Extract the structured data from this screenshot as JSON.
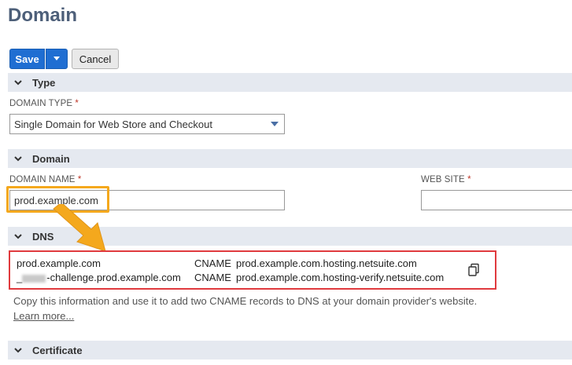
{
  "page": {
    "title": "Domain"
  },
  "toolbar": {
    "save_label": "Save",
    "cancel_label": "Cancel"
  },
  "sections": {
    "type": "Type",
    "domain": "Domain",
    "dns": "DNS",
    "certificate": "Certificate"
  },
  "type_section": {
    "domain_type_label": "DOMAIN TYPE",
    "domain_type_value": "Single Domain for Web Store and Checkout"
  },
  "domain_section": {
    "domain_name_label": "DOMAIN NAME",
    "domain_name_value": "prod.example.com",
    "web_site_label": "WEB SITE",
    "web_site_value": ""
  },
  "required_marker": "*",
  "dns_records": [
    {
      "host": "prod.example.com",
      "type": "CNAME",
      "value": "prod.example.com.hosting.netsuite.com"
    },
    {
      "host_prefix": "_",
      "host": "-challenge.prod.example.com",
      "type": "CNAME",
      "value": "prod.example.com.hosting-verify.netsuite.com"
    }
  ],
  "dns_note": "Copy this information and use it to add two CNAME records to DNS at your domain provider's website.",
  "learn_more": "Learn more...",
  "colors": {
    "primary_button": "#1f6ed2",
    "section_header_bg": "#e5e9f0",
    "highlight_orange": "#f4a81d",
    "highlight_red": "#e03a3e",
    "title": "#4d5f79"
  },
  "icons": {
    "save_menu": "caret-down-icon",
    "section_toggle": "chevron-down-icon",
    "select_arrow": "caret-down-icon",
    "copy": "copy-icon",
    "callout": "arrow-icon"
  }
}
